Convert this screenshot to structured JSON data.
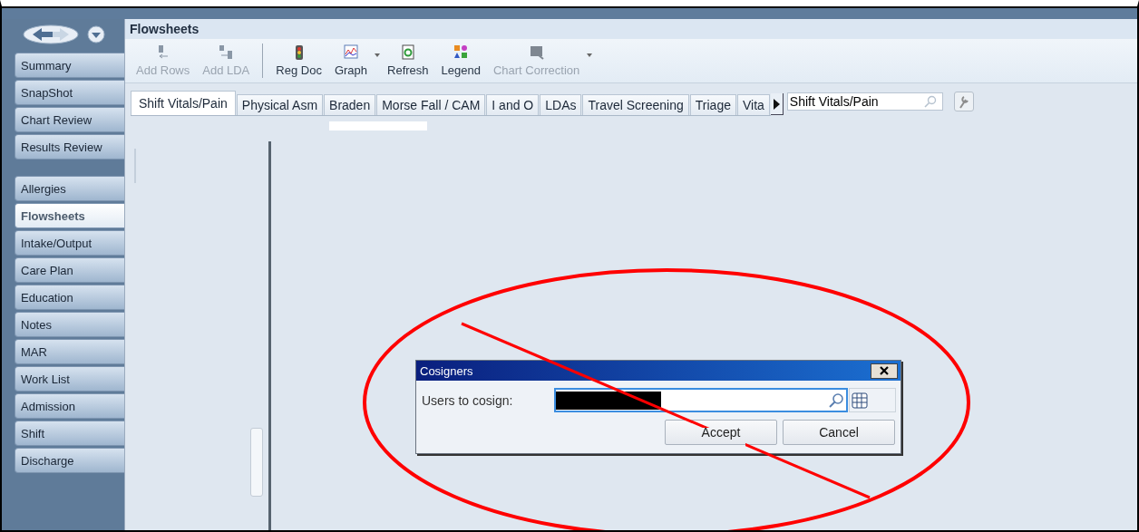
{
  "sidebar": {
    "groups": [
      {
        "items": [
          {
            "label": "Summary",
            "selected": false
          },
          {
            "label": "SnapShot",
            "selected": false
          },
          {
            "label": "Chart Review",
            "selected": false
          },
          {
            "label": "Results Review",
            "selected": false
          }
        ]
      },
      {
        "items": [
          {
            "label": "Allergies",
            "selected": false
          },
          {
            "label": "Flowsheets",
            "selected": true
          },
          {
            "label": "Intake/Output",
            "selected": false
          },
          {
            "label": "Care Plan",
            "selected": false
          },
          {
            "label": "Education",
            "selected": false
          },
          {
            "label": "Notes",
            "selected": false
          },
          {
            "label": "MAR",
            "selected": false
          },
          {
            "label": "Work List",
            "selected": false
          },
          {
            "label": "Admission",
            "selected": false
          },
          {
            "label": "Shift",
            "selected": false
          },
          {
            "label": "Discharge",
            "selected": false
          }
        ]
      }
    ]
  },
  "activity": {
    "title": "Flowsheets"
  },
  "toolbar": [
    {
      "label": "Add Rows",
      "kind": "add-rows",
      "disabled": true,
      "dropdown": false
    },
    {
      "label": "Add LDA",
      "kind": "add-lda",
      "disabled": true,
      "dropdown": false,
      "separator_after": true
    },
    {
      "label": "Reg Doc",
      "kind": "traffic-light",
      "disabled": false,
      "dropdown": false
    },
    {
      "label": "Graph",
      "kind": "graph",
      "disabled": false,
      "dropdown": true
    },
    {
      "label": "Refresh",
      "kind": "refresh",
      "disabled": false,
      "dropdown": false
    },
    {
      "label": "Legend",
      "kind": "legend",
      "disabled": false,
      "dropdown": false
    },
    {
      "label": "Chart Correction",
      "kind": "chart-correction",
      "disabled": true,
      "dropdown": true
    }
  ],
  "tabs": [
    {
      "label": "Shift Vitals/Pain",
      "selected": true
    },
    {
      "label": "Physical Asm",
      "selected": false
    },
    {
      "label": "Braden",
      "selected": false
    },
    {
      "label": "Morse Fall / CAM",
      "selected": false
    },
    {
      "label": "I and O",
      "selected": false
    },
    {
      "label": "LDAs",
      "selected": false
    },
    {
      "label": "Travel Screening",
      "selected": false
    },
    {
      "label": "Triage",
      "selected": false
    },
    {
      "label": "Vita",
      "selected": false
    }
  ],
  "tab_search": {
    "value": "Shift Vitals/Pain"
  },
  "dialog": {
    "title": "Cosigners",
    "field_label": "Users to cosign:",
    "value_redacted": true,
    "buttons": [
      "Accept",
      "Cancel"
    ]
  },
  "annotation": {
    "ellipse": true,
    "strike_line": true
  }
}
